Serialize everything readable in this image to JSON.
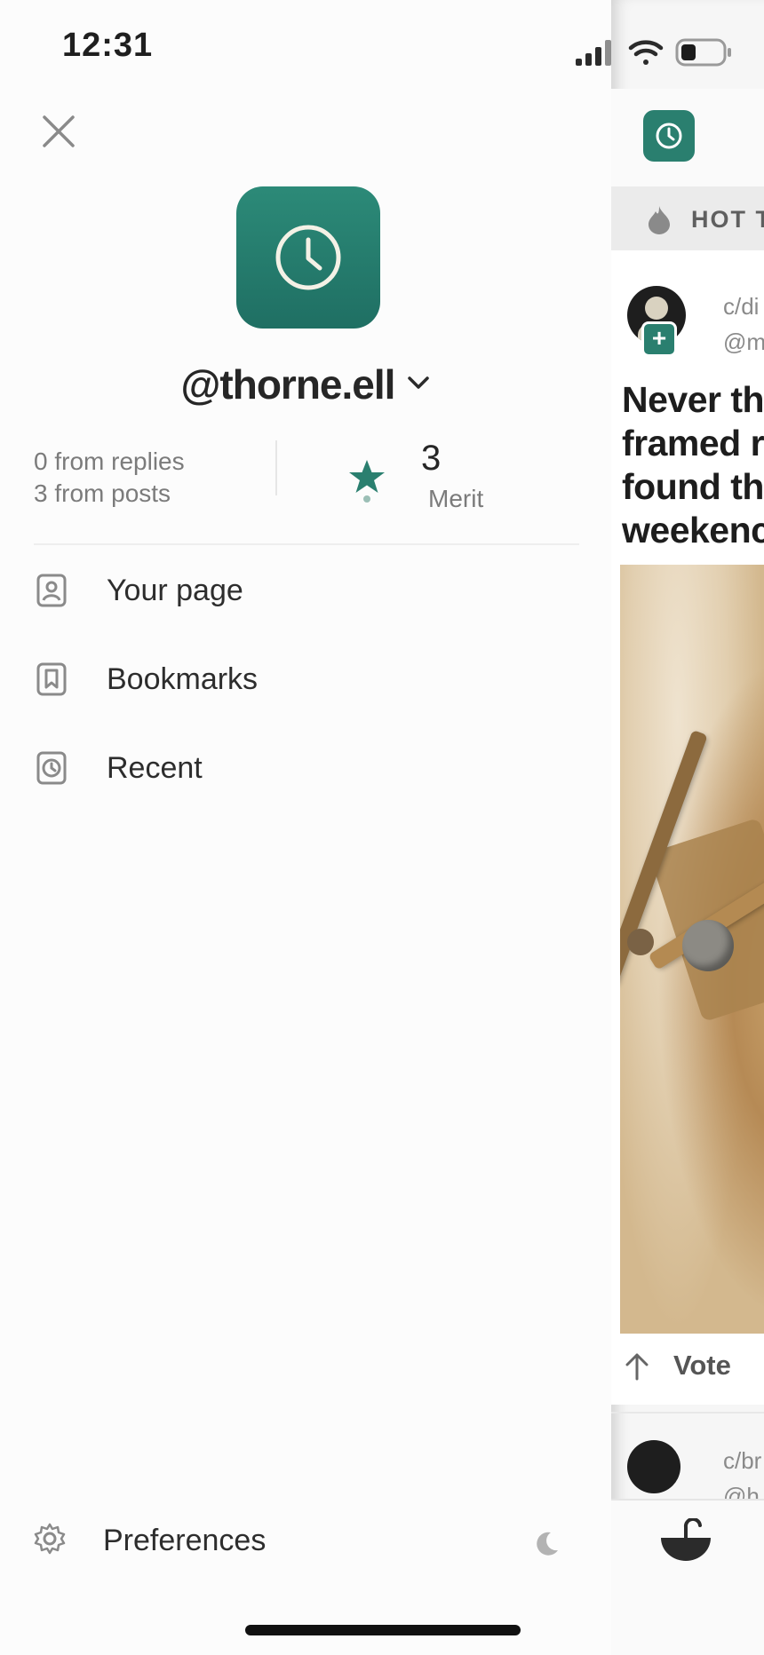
{
  "status_bar": {
    "time": "12:31"
  },
  "drawer": {
    "username": "@thorne.ell",
    "stats": {
      "from_replies": "0 from replies",
      "from_posts": "3 from posts",
      "merit_value": "3",
      "merit_label": "Merit"
    },
    "menu": [
      {
        "label": "Your page",
        "icon": "user-page-icon"
      },
      {
        "label": "Bookmarks",
        "icon": "bookmark-icon"
      },
      {
        "label": "Recent",
        "icon": "clock-icon"
      }
    ],
    "preferences_label": "Preferences"
  },
  "feed": {
    "sort_label": "HOT T",
    "post": {
      "community": "c/di",
      "author": "@m",
      "title_lines": [
        "Never th",
        "framed r",
        "found th",
        "weekenc"
      ],
      "vote_label": "Vote"
    },
    "post2": {
      "community": "c/br",
      "author": "@h"
    }
  },
  "colors": {
    "accent": "#2a7f6f",
    "text": "#2a2a2a",
    "muted": "#7b7b7b"
  }
}
